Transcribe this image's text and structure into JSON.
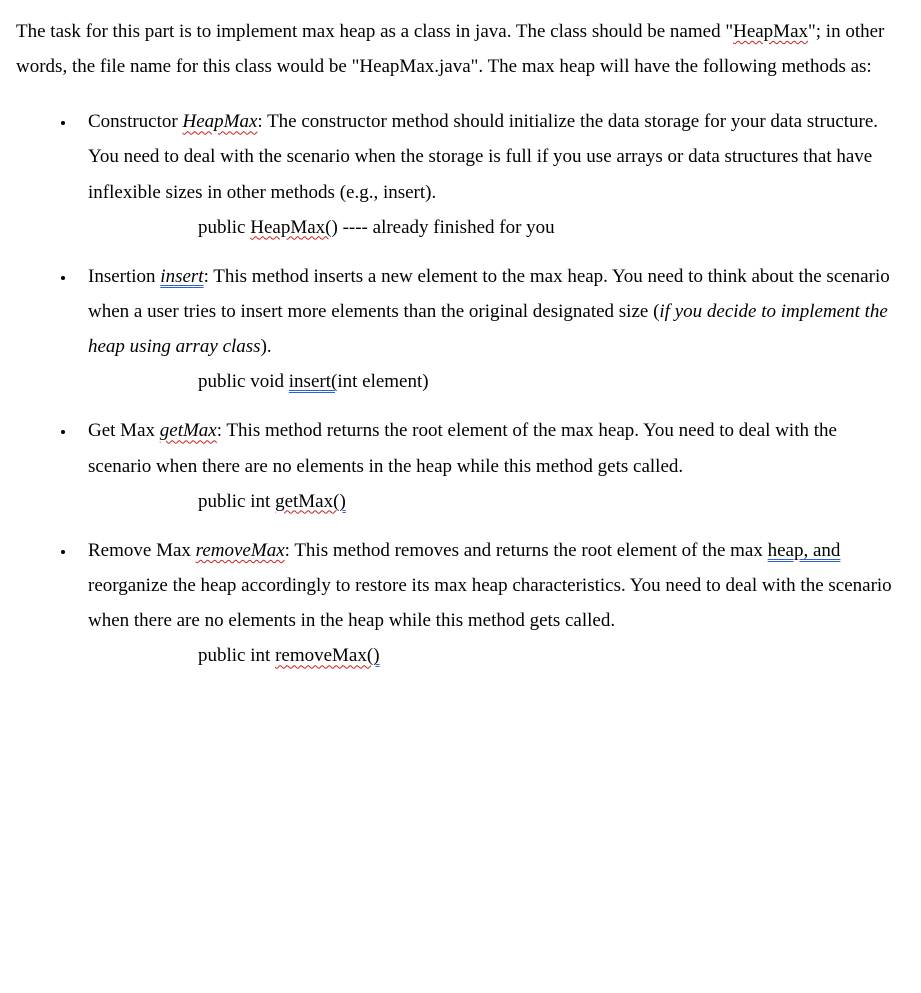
{
  "intro": {
    "t1": "The task for this part is to implement max heap as a class in java. The class should be named \"",
    "t2": "HeapMax",
    "t3": "\"; in other words, the file name for this class would be \"HeapMax.java\". The max heap will have the following methods as:"
  },
  "items": [
    {
      "parts": [
        {
          "text": "Constructor "
        },
        {
          "text": "HeapMax",
          "cls": "spell-red ital"
        },
        {
          "text": ": The constructor method should initialize the data storage for your data structure. You need to deal with the scenario when the storage is full if you use arrays or data structures that have inflexible sizes in other methods (e.g., insert)."
        }
      ],
      "sig": [
        {
          "text": "public "
        },
        {
          "text": "HeapMax(",
          "cls": "spell-red"
        },
        {
          "text": ") ---- already finished for you"
        }
      ]
    },
    {
      "parts": [
        {
          "text": "Insertion "
        },
        {
          "text": "insert",
          "cls": "gram-blue ital"
        },
        {
          "text": ": This method inserts a new element to the max heap. You need to think about the scenario when a user tries to insert more elements than the original designated size ("
        },
        {
          "text": "if you decide to implement the heap using array class",
          "cls": "ital"
        },
        {
          "text": ")."
        }
      ],
      "sig": [
        {
          "text": "public void "
        },
        {
          "text": "insert(",
          "cls": "gram-blue"
        },
        {
          "text": "int element)"
        }
      ]
    },
    {
      "parts": [
        {
          "text": "Get Max "
        },
        {
          "text": "getMax",
          "cls": "spell-red ital"
        },
        {
          "text": ": This method returns the root element of the max heap. You need to deal with the scenario when there are no elements in the heap while this method gets called."
        }
      ],
      "sig": [
        {
          "text": "public int "
        },
        {
          "text": "getMax(",
          "cls": "spell-red"
        },
        {
          "text": ")",
          "cls": "gram-blue"
        }
      ]
    },
    {
      "parts": [
        {
          "text": "Remove Max "
        },
        {
          "text": "removeMax",
          "cls": "spell-red ital"
        },
        {
          "text": ": This method removes and returns the root element of the max "
        },
        {
          "text": "heap, and",
          "cls": "gram-blue"
        },
        {
          "text": " reorganize the heap accordingly to restore its max heap characteristics. You need to deal with the scenario when there are no elements in the heap while this method gets called."
        }
      ],
      "sig": [
        {
          "text": "public int "
        },
        {
          "text": "removeMax(",
          "cls": "spell-red"
        },
        {
          "text": ")",
          "cls": "gram-blue"
        }
      ]
    }
  ]
}
